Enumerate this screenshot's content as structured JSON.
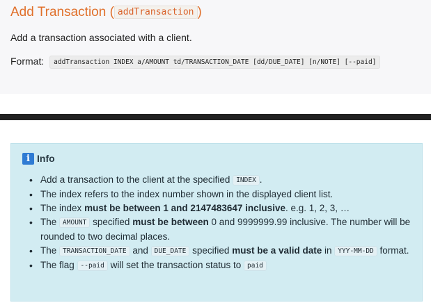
{
  "section": {
    "title": "Add Transaction",
    "title_open": "(",
    "title_code": "addTransaction",
    "title_close": ")",
    "description": "Add a transaction associated with a client.",
    "format_label": "Format:",
    "format_code": "addTransaction INDEX a/AMOUNT td/TRANSACTION_DATE [dd/DUE_DATE] [n/NOTE] [--paid]"
  },
  "info_box": {
    "icon": "info-icon",
    "icon_glyph": "i",
    "title": "Info",
    "items": [
      {
        "t1": "Add a transaction to the client at the specified",
        "code1": "INDEX",
        "t2": "."
      },
      {
        "t1": "The index refers to the index number shown in the displayed client list."
      },
      {
        "t1": "The index",
        "b1": "must be between 1 and 2147483647 inclusive",
        "t2": ". e.g. 1, 2, 3, …"
      },
      {
        "t1": "The",
        "code1": "AMOUNT",
        "t2": "specified",
        "b1": "must be between",
        "t3": "0 and 9999999.99 inclusive. The number will be rounded to two decimal places."
      },
      {
        "t1": "The",
        "code1": "TRANSACTION_DATE",
        "t2": "and",
        "code2": "DUE_DATE",
        "t3": "specified",
        "b1": "must be a valid date",
        "t4": "in",
        "code3": "YYY-MM-DD",
        "t5": "format."
      },
      {
        "t1": "The flag",
        "code1": "--paid",
        "t2": "will set the transaction status to",
        "code2": "paid"
      }
    ]
  },
  "colors": {
    "heading": "#e0702b",
    "info_background": "#d2ecf2",
    "info_icon": "#2f7bd3",
    "divider": "#222222"
  }
}
